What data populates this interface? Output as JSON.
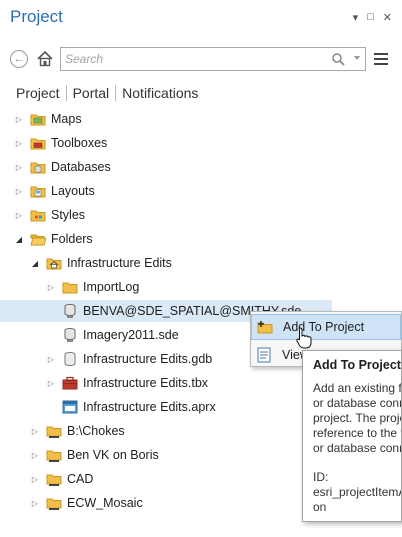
{
  "window": {
    "title": "Project",
    "controls": {
      "options": "▾",
      "restore": "□",
      "close": "✕"
    }
  },
  "toolbar": {
    "search_placeholder": "Search"
  },
  "tabs": [
    {
      "label": "Project"
    },
    {
      "label": "Portal"
    },
    {
      "label": "Notifications"
    }
  ],
  "tree": {
    "items": [
      {
        "label": "Maps"
      },
      {
        "label": "Toolboxes"
      },
      {
        "label": "Databases"
      },
      {
        "label": "Layouts"
      },
      {
        "label": "Styles"
      },
      {
        "label": "Folders"
      },
      {
        "label": "Infrastructure Edits"
      },
      {
        "label": "ImportLog"
      },
      {
        "label": "BENVA@SDE_SPATIAL@SMITHY.sde"
      },
      {
        "label": "Imagery2011.sde"
      },
      {
        "label": "Infrastructure Edits.gdb"
      },
      {
        "label": "Infrastructure Edits.tbx"
      },
      {
        "label": "Infrastructure Edits.aprx"
      },
      {
        "label": "B:\\Chokes"
      },
      {
        "label": "Ben VK on Boris"
      },
      {
        "label": "CAD"
      },
      {
        "label": "ECW_Mosaic"
      }
    ]
  },
  "context_menu": {
    "items": [
      {
        "label": "Add To Project"
      },
      {
        "label": "View"
      }
    ]
  },
  "tooltip": {
    "title": "Add To Project",
    "lines": [
      "Add an existing f",
      "or database conn",
      "project. The proje",
      "reference to the f",
      "or database conn"
    ],
    "id_label": "ID:",
    "id_value": "esri_projectItemA",
    "id_tail": "on"
  },
  "colors": {
    "title": "#2a6fb4",
    "selection": "#dbe8f5",
    "folder": "#f0c04a",
    "menu_highlight": "#cfe3f6"
  }
}
